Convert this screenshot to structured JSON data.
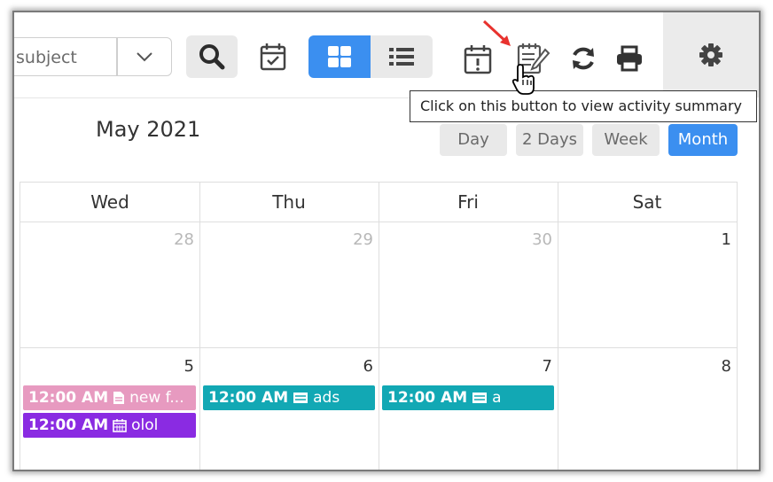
{
  "toolbar": {
    "subject_text": "subject",
    "icons": [
      "chevron-down-icon",
      "search-icon",
      "calendar-check-icon",
      "grid-view-icon",
      "list-view-icon",
      "calendar-alert-icon",
      "activity-summary-icon",
      "refresh-icon",
      "print-icon",
      "gear-icon"
    ]
  },
  "tooltip": {
    "text": "Click on this button to view activity summary"
  },
  "calendar": {
    "title": "May 2021",
    "views": [
      {
        "label": "Day",
        "active": false
      },
      {
        "label": "2 Days",
        "active": false
      },
      {
        "label": "Week",
        "active": false
      },
      {
        "label": "Month",
        "active": true
      }
    ],
    "days_of_week": [
      "Wed",
      "Thu",
      "Fri",
      "Sat"
    ],
    "weeks": [
      [
        {
          "day": "28",
          "current": false
        },
        {
          "day": "29",
          "current": false
        },
        {
          "day": "30",
          "current": false
        },
        {
          "day": "1",
          "current": true
        }
      ],
      [
        {
          "day": "5",
          "current": true
        },
        {
          "day": "6",
          "current": true
        },
        {
          "day": "7",
          "current": true
        },
        {
          "day": "8",
          "current": true
        }
      ]
    ],
    "events": [
      {
        "time": "12:00 AM",
        "title": "new f...",
        "color": "#e79ac0",
        "icon": "document-icon"
      },
      {
        "time": "12:00 AM",
        "title": "olol",
        "color": "#8a2be2",
        "icon": "calendar-icon"
      },
      {
        "time": "12:00 AM",
        "title": "ads",
        "color": "#12a8b4",
        "icon": "card-icon"
      },
      {
        "time": "12:00 AM",
        "title": "a",
        "color": "#12a8b4",
        "icon": "card-icon"
      }
    ]
  },
  "colors": {
    "accent": "#3b8ff0",
    "pointer_arrow": "#e8322e"
  }
}
